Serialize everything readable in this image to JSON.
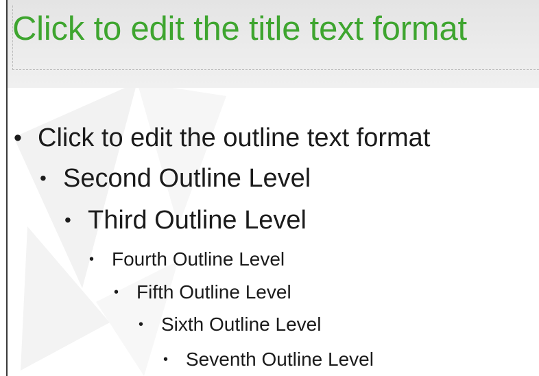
{
  "title": {
    "text": "Click to edit the title text format",
    "color": "#3ea52f"
  },
  "outline": {
    "bullet_char": "•",
    "levels": [
      "Click to edit the outline text format",
      "Second Outline Level",
      "Third Outline Level",
      "Fourth Outline Level",
      "Fifth Outline Level",
      "Sixth Outline Level",
      "Seventh Outline Level"
    ]
  }
}
